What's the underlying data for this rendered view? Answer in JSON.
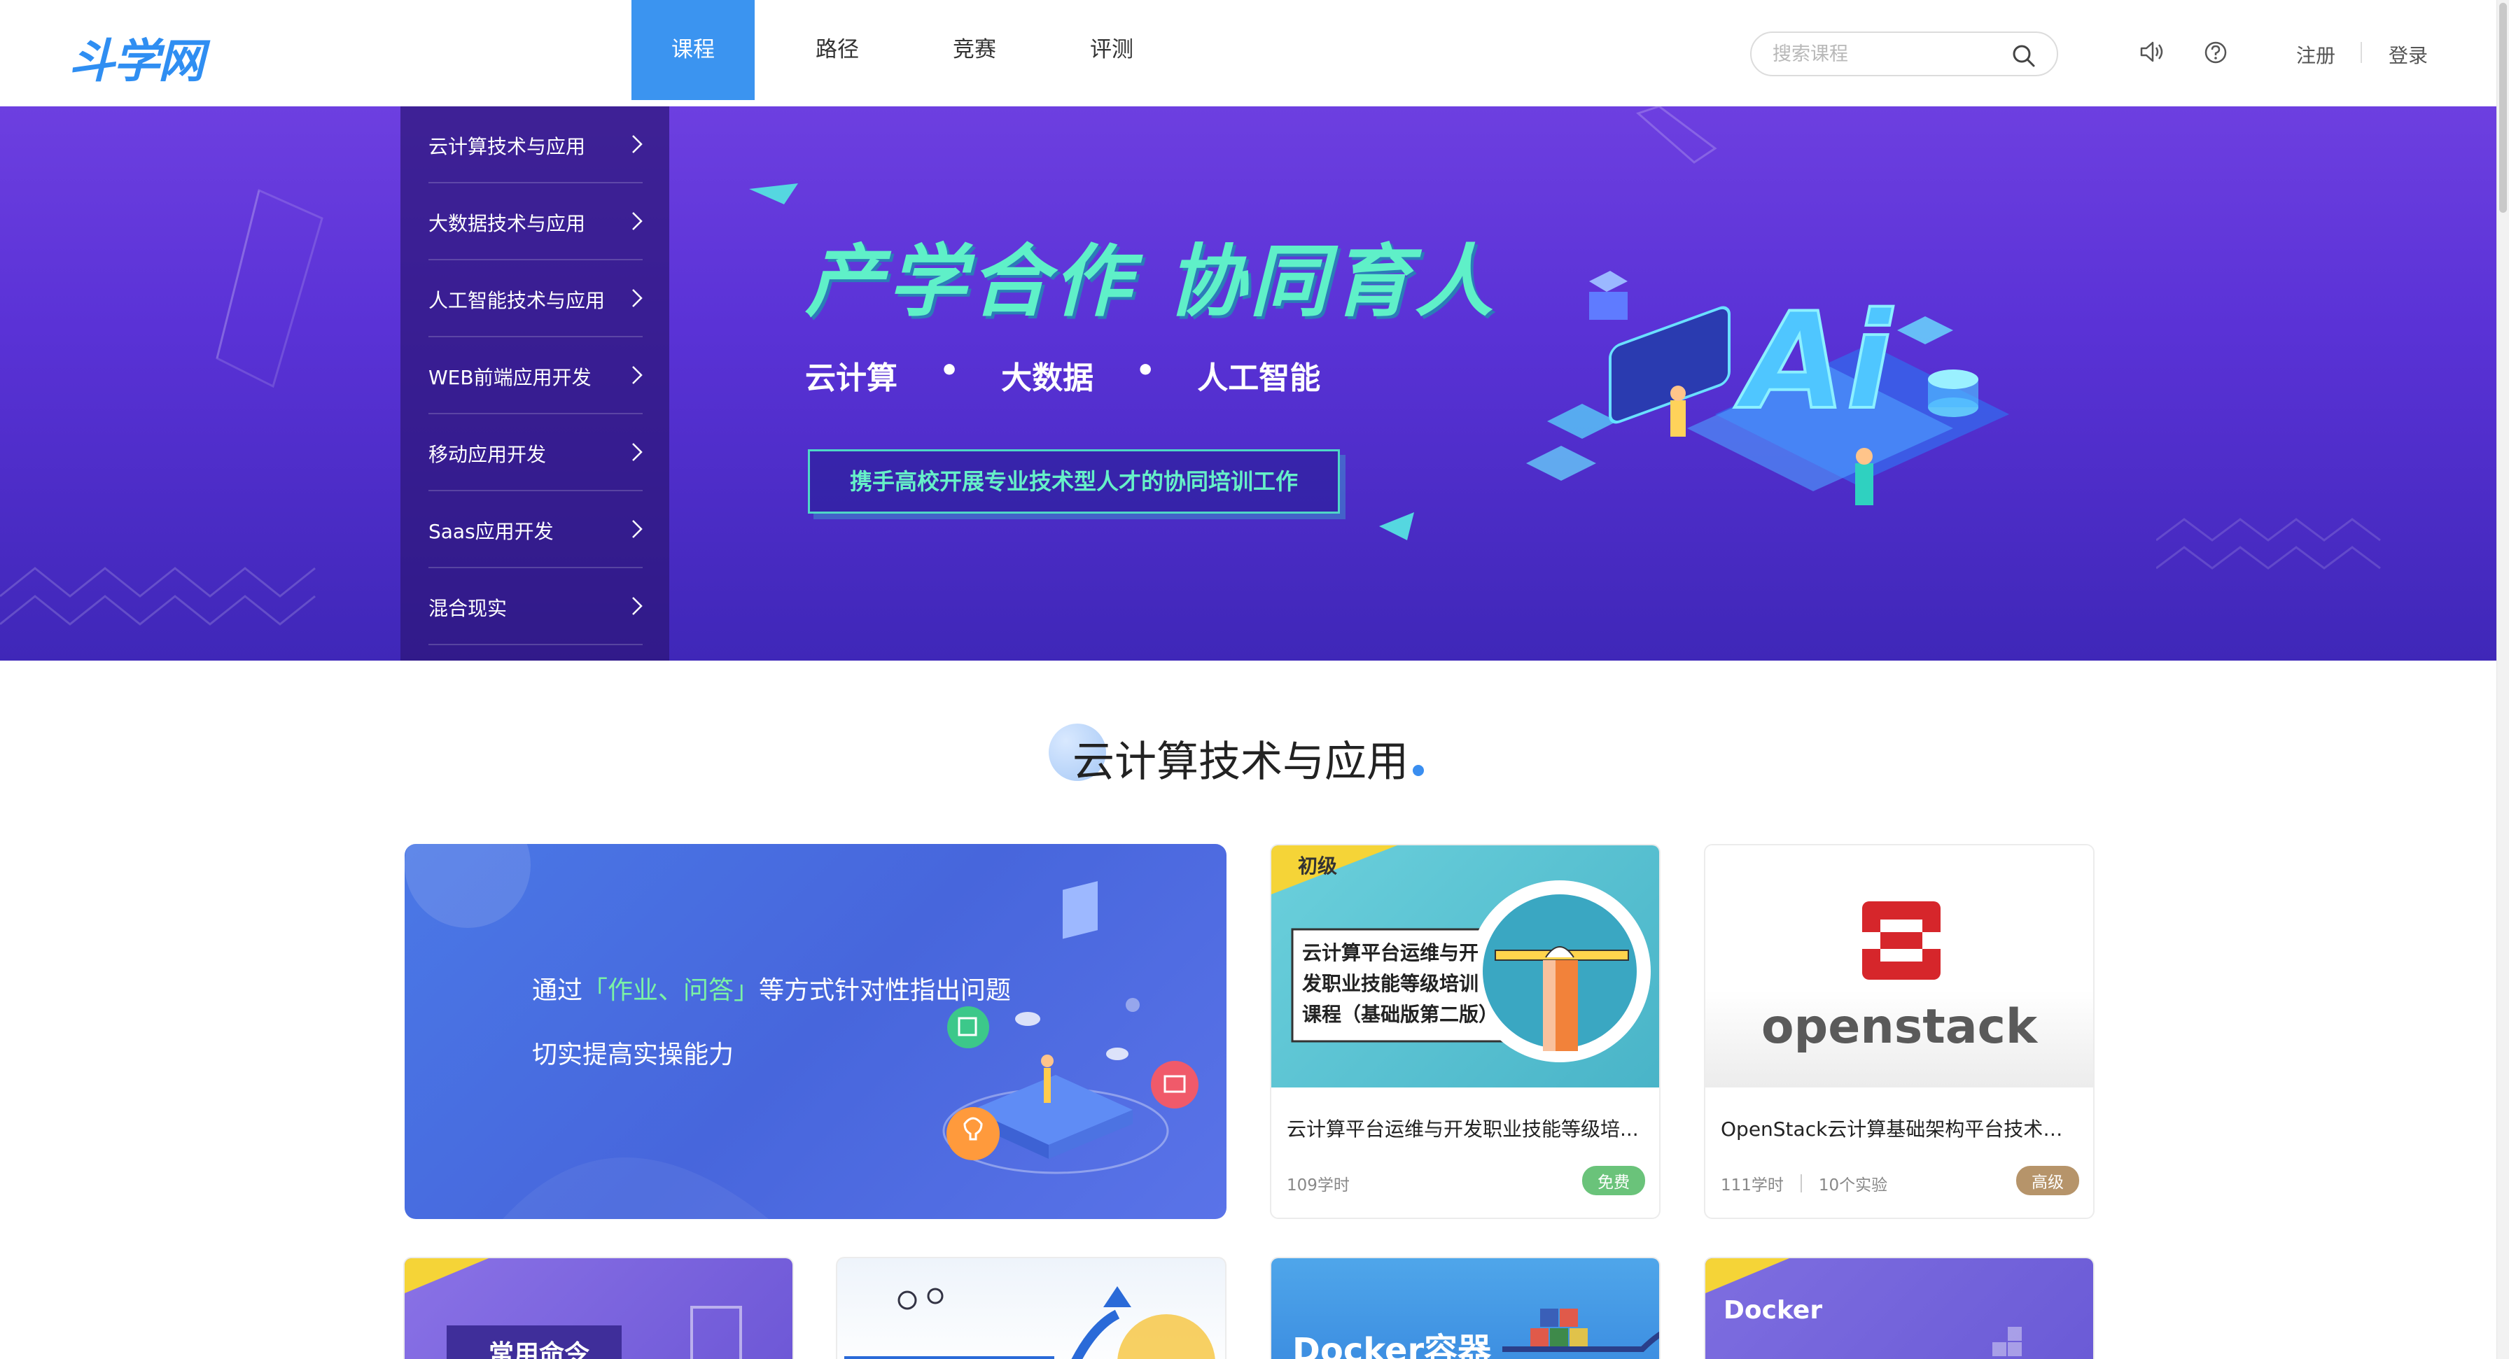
{
  "header": {
    "logo": "斗学网",
    "nav": [
      {
        "label": "课程",
        "active": true
      },
      {
        "label": "路径",
        "active": false
      },
      {
        "label": "竞赛",
        "active": false
      },
      {
        "label": "评测",
        "active": false
      }
    ],
    "search_placeholder": "搜索课程",
    "register": "注册",
    "login": "登录",
    "icons": [
      "speaker-icon",
      "help-icon",
      "search-icon"
    ]
  },
  "banner": {
    "side_menu": [
      "云计算技术与应用",
      "大数据技术与应用",
      "人工智能技术与应用",
      "WEB前端应用开发",
      "移动应用开发",
      "Saas应用开发",
      "混合现实"
    ],
    "title": "产学合作 协同育人",
    "subtitles": [
      "云计算",
      "大数据",
      "人工智能"
    ],
    "separator": "•",
    "button": "携手高校开展专业技术型人才的协同培训工作",
    "art_text": "Ai"
  },
  "section": {
    "title": "云计算技术与应用"
  },
  "feature_card": {
    "line1_prefix": "通过",
    "line1_highlight": "「作业、问答」",
    "line1_suffix": "等方式针对性指出问题",
    "line2": "切实提高实操能力"
  },
  "courses": [
    {
      "corner_label": "初级",
      "thumb_text": "云计算平台运维与开发职业技能等级培训课程（基础版第二版）",
      "thumb_lines": [
        "云计算平台运维与开",
        "发职业技能等级培训",
        "课程（基础版第二版）"
      ],
      "title": "云计算平台运维与开发职业技能等级培...",
      "hours": "109学时",
      "badge": "免费",
      "colors": {
        "thumb": "#5ec6d6",
        "badge": "#6ac37a"
      }
    },
    {
      "thumb_text": "openstack",
      "title": "OpenStack云计算基础架构平台技术与...",
      "hours": "111学时",
      "experiments": "10个实验",
      "badge": "高级",
      "colors": {
        "thumb": "#ffffff",
        "badge": "#b6946a"
      }
    }
  ],
  "bottom_cards": [
    {
      "thumb_text": "常用命令"
    },
    {
      "thumb_text": ""
    },
    {
      "thumb_text": "Docker容器"
    },
    {
      "thumb_text": "Docker"
    }
  ],
  "colors": {
    "accent": "#3b94f0",
    "banner_top": "#6d3fe0",
    "banner_bottom": "#3f27b8",
    "banner_title": "#5ff0c8"
  }
}
